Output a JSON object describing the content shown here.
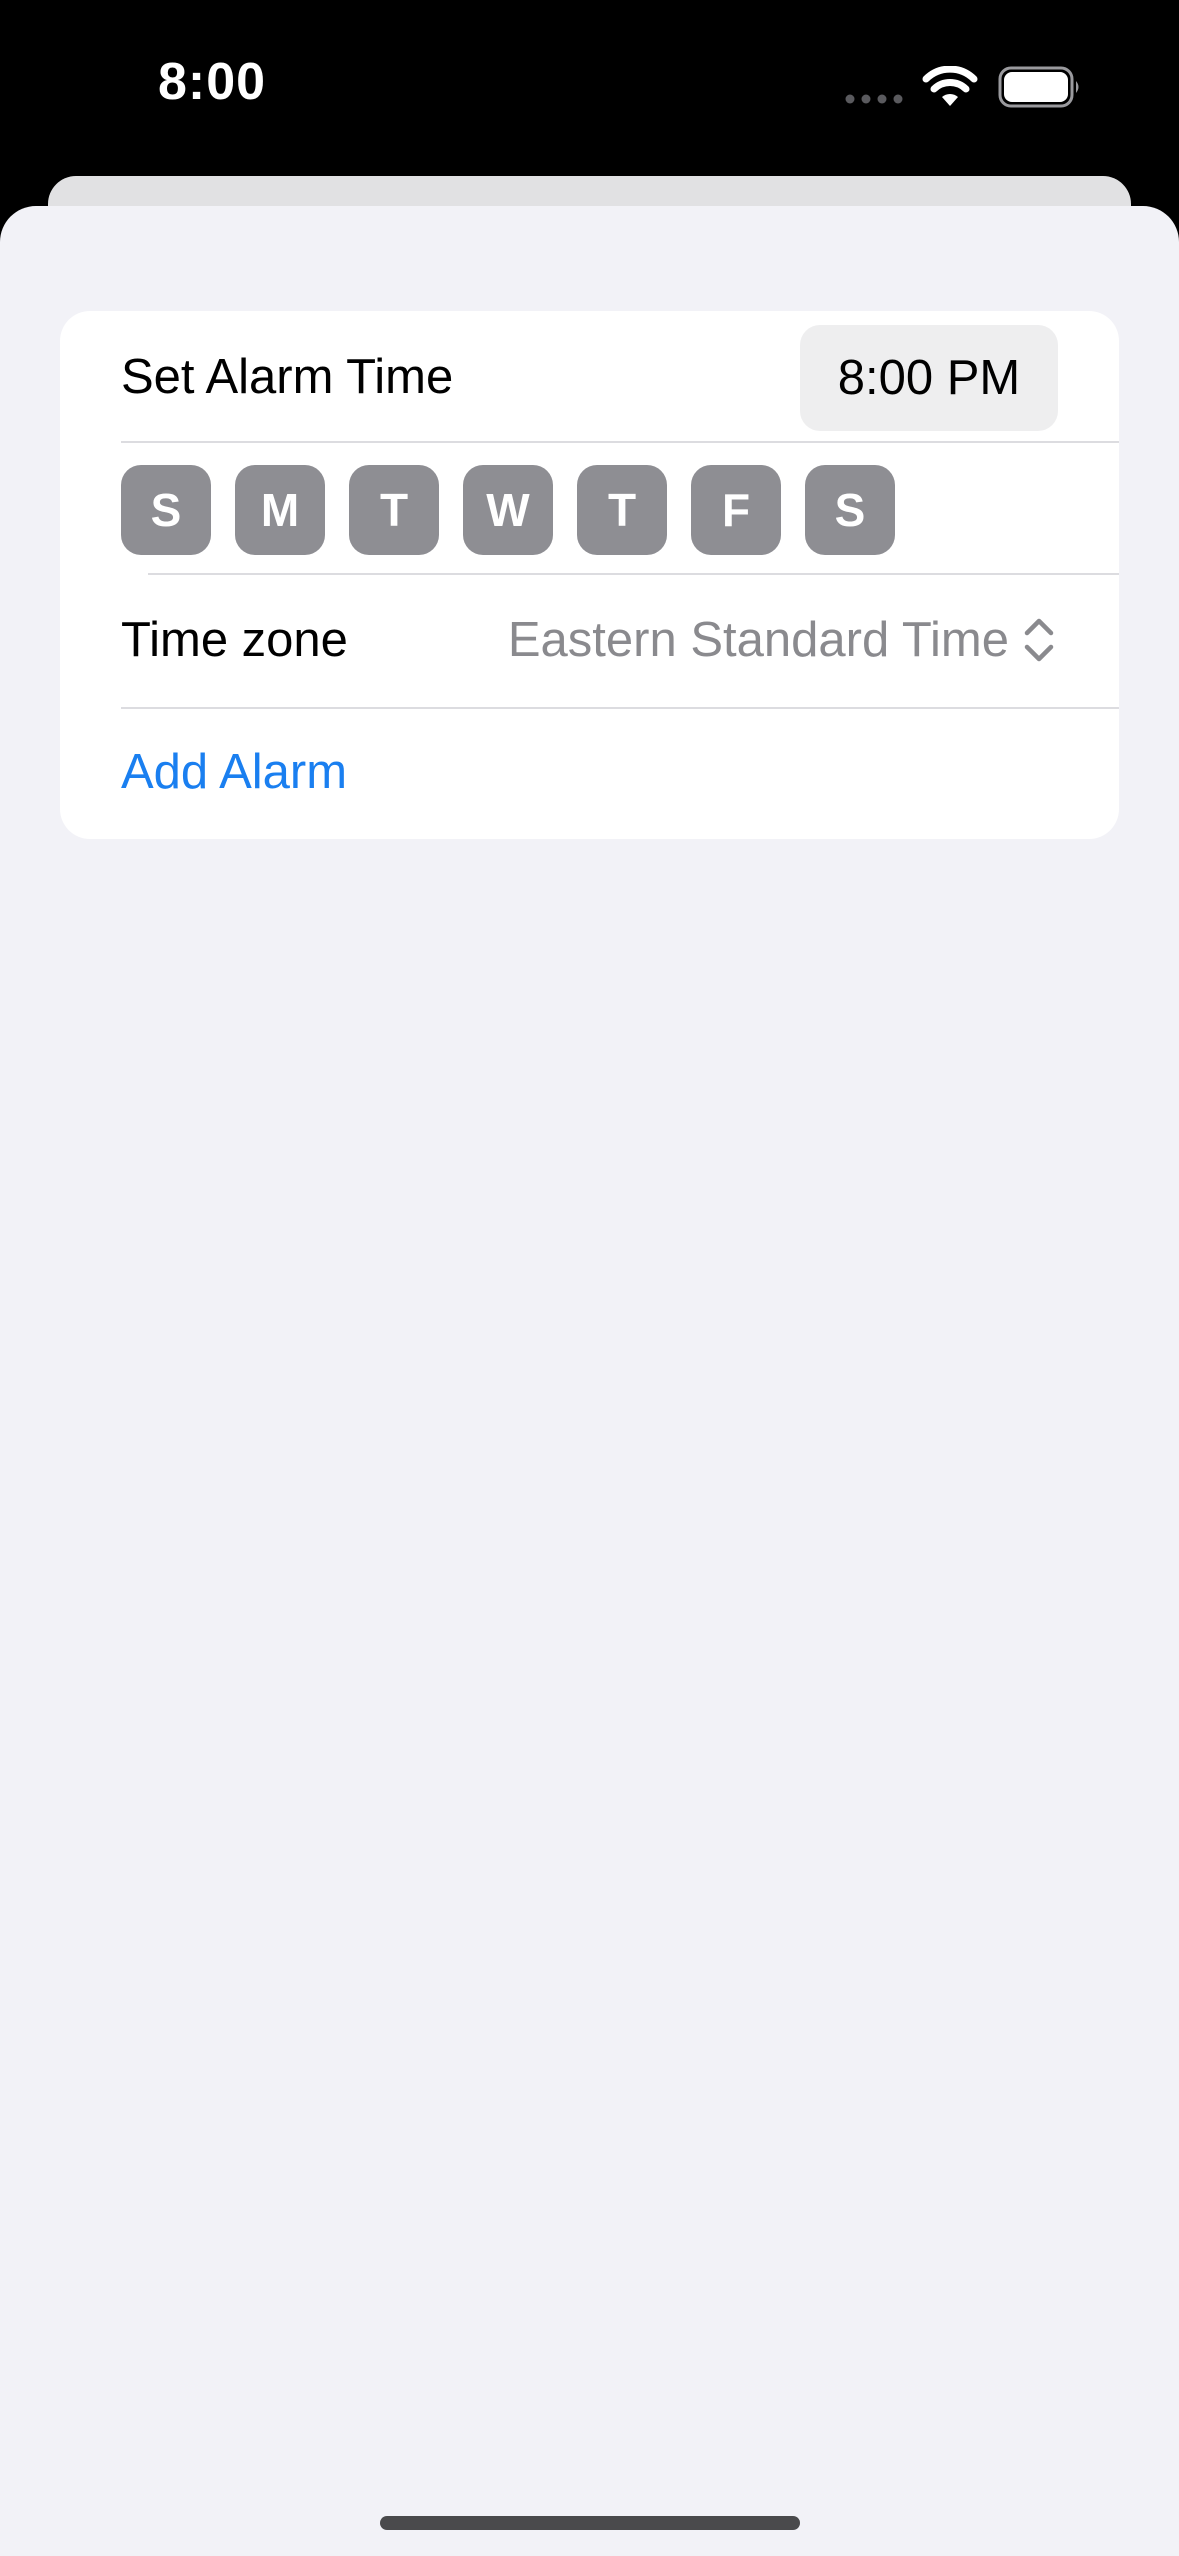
{
  "status_bar": {
    "time": "8:00",
    "icons": [
      "cellular-dots-icon",
      "wifi-icon",
      "battery-icon"
    ]
  },
  "form": {
    "alarm_time_label": "Set Alarm Time",
    "alarm_time_value": "8:00 PM",
    "days": [
      "S",
      "M",
      "T",
      "W",
      "T",
      "F",
      "S"
    ],
    "timezone_label": "Time zone",
    "timezone_value": "Eastern Standard Time",
    "add_alarm_label": "Add Alarm"
  },
  "colors": {
    "accent": "#1a7ff0",
    "day_button": "#8e8e93",
    "sheet_background": "#f2f2f7",
    "secondary_text": "#8a8a8e"
  }
}
